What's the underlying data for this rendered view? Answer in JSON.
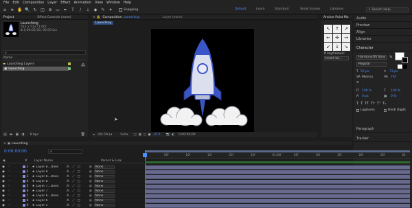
{
  "menu": [
    "File",
    "Edit",
    "Composition",
    "Layer",
    "Effect",
    "Animation",
    "View",
    "Window",
    "Help"
  ],
  "toolbar": {
    "snapping": "Snapping"
  },
  "workspaces": [
    "Default",
    "Learn",
    "Standard",
    "Small Screen",
    "Libraries"
  ],
  "search_help": "Search Help",
  "project": {
    "tabs": [
      "Project",
      "Effect Controls (none)"
    ],
    "comp_name": "Launching",
    "comp_info1": "512 x 512 (1.00)",
    "comp_info2": "Δ 0;00;02;00, 60.00 fps",
    "search_placeholder": "",
    "col_name": "Name",
    "items": [
      "Launching Layers",
      "Launching"
    ],
    "bpc": "8 bpc"
  },
  "comp_panel": {
    "tab": "Composition",
    "tab_name": "Launching",
    "layer_tab": "Layer (none)",
    "breadcrumb": "Launching",
    "zoom": "(94.5%)",
    "quality": "Full",
    "timecode": "0;00;00;00",
    "exposure": "+0.0"
  },
  "anchor_panel": {
    "title": "Anchor Point Mo",
    "keyframed": "If keyframed:",
    "insert": "Insert ke..."
  },
  "right_sections": [
    "Audio",
    "Preview",
    "Align",
    "Libraries",
    "Character",
    "Paragraph",
    "Tracker"
  ],
  "character": {
    "font": "HarmonyOS Sans",
    "style": "Regular",
    "size": "52 px",
    "leading": "73 px",
    "kerning": "Metrics",
    "tracking": "767",
    "vscale": "100 %",
    "hscale": "100 %",
    "baseline": "0 px",
    "tsume": "0 %",
    "ligatures": "Ligatures",
    "hindi": "Hindi Digits"
  },
  "timeline": {
    "comp_tab": "Launching",
    "timecode": "0:00:00:00",
    "col_layer": "Layer Name",
    "col_parent": "Parent & Link",
    "ticks": [
      "05f",
      "10f",
      "15f",
      "20f",
      "25f",
      "01:00f",
      "05f",
      "10f",
      "15f",
      "20f",
      "25f",
      "02:"
    ],
    "layers": [
      {
        "num": "1",
        "name": "Layer 8...Ones",
        "parent": "None"
      },
      {
        "num": "2",
        "name": "Layer 9",
        "parent": "None"
      },
      {
        "num": "3",
        "name": "Layer 8...Ones",
        "parent": "None"
      },
      {
        "num": "4",
        "name": "Layer 8",
        "parent": "None"
      },
      {
        "num": "5",
        "name": "Layer 7...Ones",
        "parent": "None"
      },
      {
        "num": "6",
        "name": "Layer 7",
        "parent": "None"
      },
      {
        "num": "7",
        "name": "Layer 6...Ones",
        "parent": "None"
      },
      {
        "num": "8",
        "name": "Layer 6",
        "parent": "None"
      },
      {
        "num": "9",
        "name": "Layer 5",
        "parent": "None"
      }
    ],
    "frames": "Frame Render Time  0ms"
  },
  "colors": {
    "accent": "#4a90ff",
    "layer_bar": "#67698d",
    "rocket_blue": "#3a55c8"
  }
}
